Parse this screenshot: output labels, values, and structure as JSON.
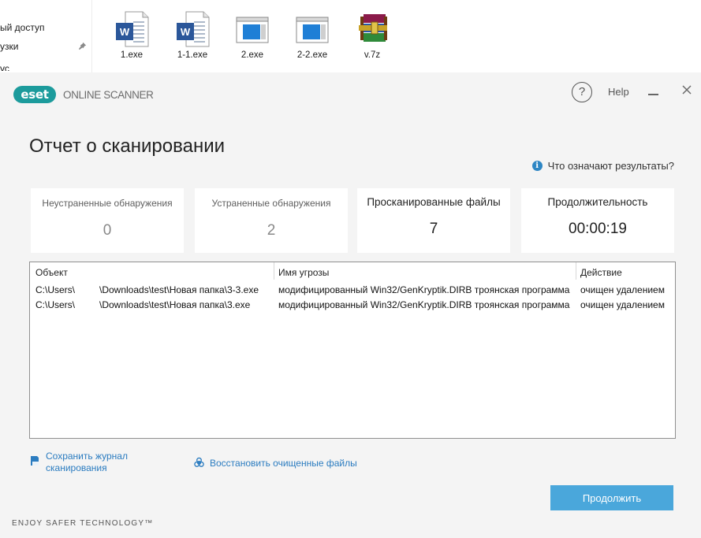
{
  "explorer": {
    "nav_items": [
      "ый доступ",
      "узки",
      "ус"
    ],
    "files": [
      {
        "name": "1.exe",
        "icon": "word-doc-icon"
      },
      {
        "name": "1-1.exe",
        "icon": "word-doc-icon"
      },
      {
        "name": "2.exe",
        "icon": "app-window-icon"
      },
      {
        "name": "2-2.exe",
        "icon": "app-window-icon"
      },
      {
        "name": "v.7z",
        "icon": "winrar-archive-icon"
      }
    ]
  },
  "app": {
    "logo": "eset",
    "product": "ONLINE SCANNER",
    "help_icon": "?",
    "help_label": "Help",
    "accent_color": "#1c9b9c",
    "button_color": "#4aa7db"
  },
  "report": {
    "title": "Отчет о сканировании",
    "results_help": "Что означают результаты?",
    "stats": [
      {
        "label": "Неустраненные обнаружения",
        "value": "0"
      },
      {
        "label": "Устраненные обнаружения",
        "value": "2"
      },
      {
        "label": "Просканированные файлы",
        "value": "7"
      },
      {
        "label": "Продолжительность",
        "value": "00:00:19"
      }
    ],
    "table": {
      "columns": [
        "Объект",
        "Имя угрозы",
        "Действие"
      ],
      "rows": [
        {
          "path_start": "C:\\Users\\",
          "path_end": "\\Downloads\\test\\Новая папка\\3-3.exe",
          "threat": "модифицированный Win32/GenKryptik.DIRB троянская программа",
          "action": "очищен удалением"
        },
        {
          "path_start": "C:\\Users\\",
          "path_end": "\\Downloads\\test\\Новая папка\\3.exe",
          "threat": "модифицированный Win32/GenKryptik.DIRB троянская программа",
          "action": "очищен удалением"
        }
      ]
    },
    "save_log": [
      "Сохранить журнал",
      "сканирования"
    ],
    "restore": "Восстановить очищенные файлы",
    "continue": "Продолжить",
    "tagline": "ENJOY SAFER TECHNOLOGY™"
  }
}
